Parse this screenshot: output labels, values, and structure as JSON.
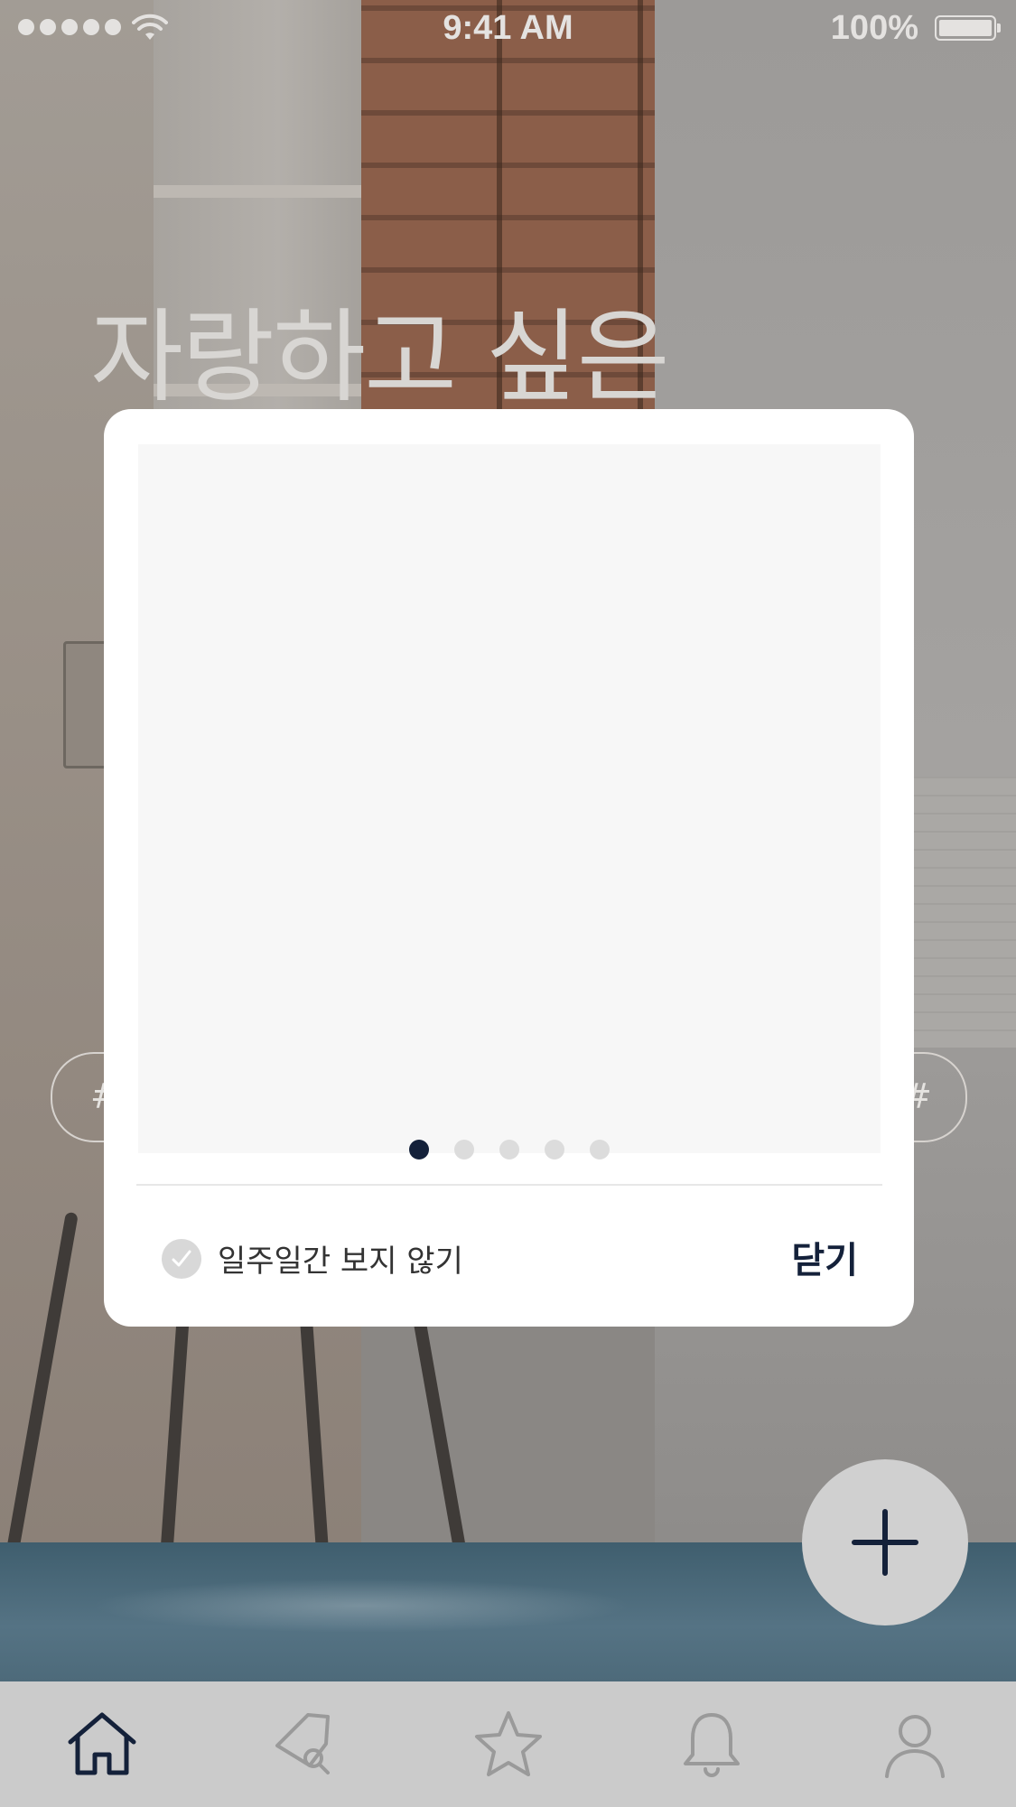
{
  "status_bar": {
    "time": "9:41 AM",
    "battery_text": "100%"
  },
  "background": {
    "headline": "자랑하고 싶은"
  },
  "modal": {
    "pager": {
      "count": 5,
      "active_index": 0
    },
    "dont_show_label": "일주일간 보지 않기",
    "close_label": "닫기"
  },
  "fab": {
    "icon": "plus-icon"
  },
  "tabbar": {
    "items": [
      {
        "icon": "home-icon",
        "active": true
      },
      {
        "icon": "tag-search-icon",
        "active": false
      },
      {
        "icon": "star-icon",
        "active": false
      },
      {
        "icon": "bell-icon",
        "active": false
      },
      {
        "icon": "user-icon",
        "active": false
      }
    ]
  },
  "colors": {
    "accent": "#14213a",
    "inactive_icon": "#9a9a9a",
    "tabbar_bg": "#cbcbcb",
    "dim_overlay": "#808080"
  }
}
